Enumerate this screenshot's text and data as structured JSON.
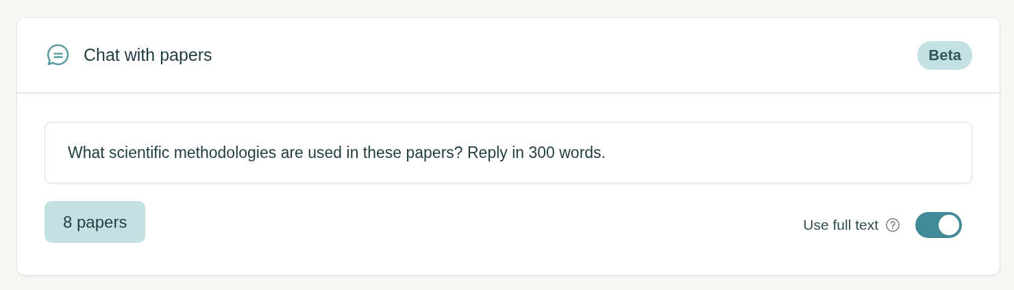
{
  "header": {
    "title": "Chat with papers",
    "badge": "Beta"
  },
  "prompt": {
    "value": "What scientific methodologies are used in these papers? Reply in 300 words."
  },
  "papers_button": {
    "label": "8 papers"
  },
  "full_text": {
    "label": "Use full text",
    "on": true
  }
}
